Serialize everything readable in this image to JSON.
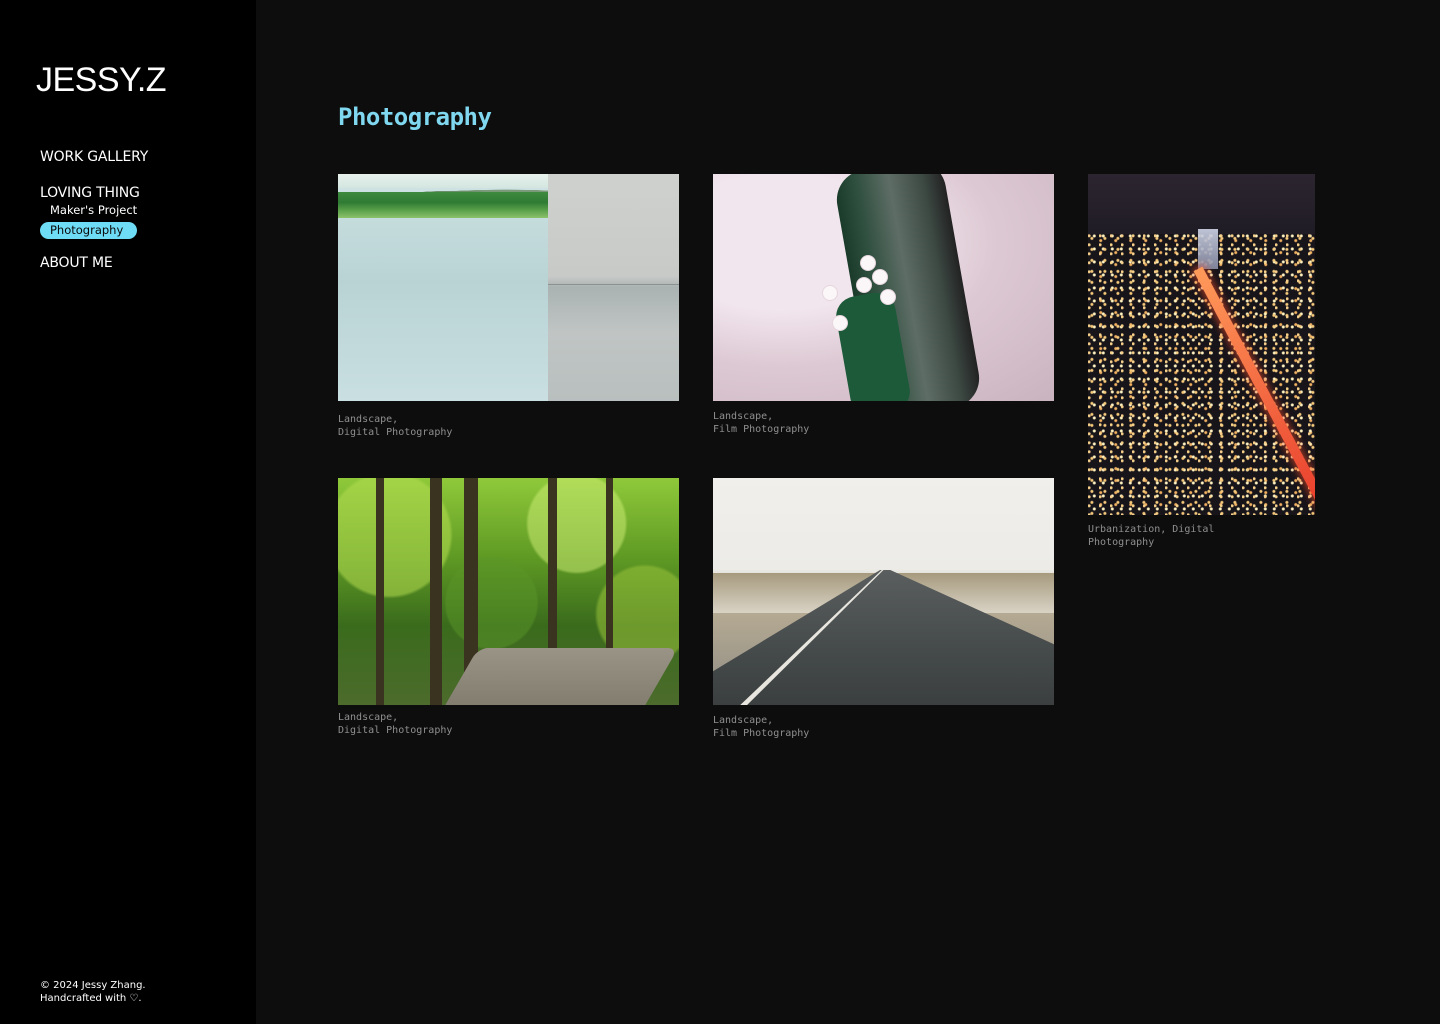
{
  "brand": {
    "logo": "JESSY.Z"
  },
  "nav": {
    "work": "WORK GALLERY",
    "loving": "LOVING THING",
    "sub_maker": "Maker's Project",
    "sub_photo": "Photography",
    "about": "ABOUT ME"
  },
  "footer": {
    "line1": "© 2024 Jessy Zhang.",
    "line2": "Handcrafted with ♡."
  },
  "page": {
    "title": "Photography"
  },
  "colors": {
    "accent": "#6fdcf5",
    "title": "#7fd8f0",
    "background": "#0d0d0d",
    "sidebar": "#000000"
  },
  "gallery": [
    {
      "caption": "Landscape,\nDigital Photography"
    },
    {
      "caption": "Landscape,\nFilm Photography"
    },
    {
      "caption": "Urbanization, Digital\nPhotography"
    },
    {
      "caption": "Landscape,\nDigital Photography"
    },
    {
      "caption": "Landscape,\nFilm Photography"
    }
  ]
}
